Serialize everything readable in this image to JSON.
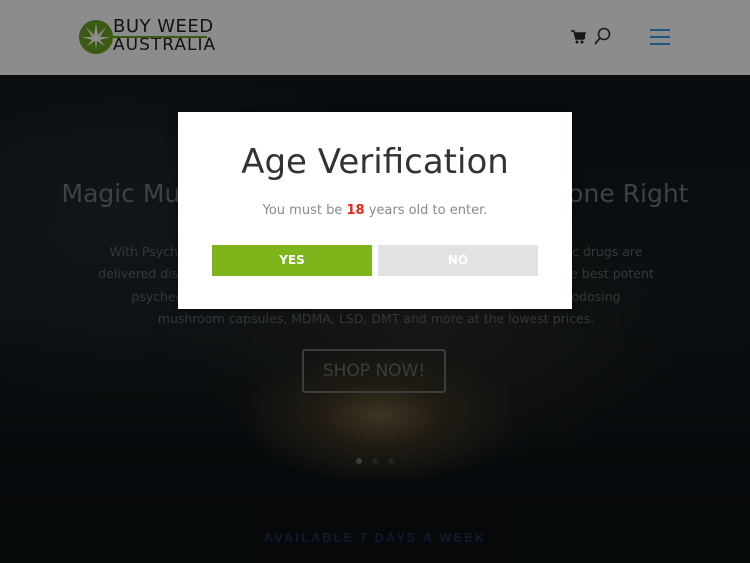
{
  "header": {
    "logo": {
      "line1": "BUY WEED",
      "line2": "AUSTRALIA"
    },
    "icons": [
      "cart-icon",
      "search-icon",
      "menu-icon"
    ],
    "accent_color": "#2ea3f2",
    "logo_green": "#6aa524"
  },
  "hero": {
    "title": "Magic Mushrooms Delivered Australia, Done Right",
    "body": "With Psychedelics Australia, your magic mushrooms and other psychedelic drugs are delivered discreetly right to your door. We specialize in sourcing some of the best potent psychedelics from around the globe including magic mushrooms, microdosing mushroom capsules, MDMA, LSD, DMT and more at the lowest prices.",
    "cta_label": "SHOP NOW!",
    "slides": 3,
    "active_slide": 1
  },
  "band": {
    "text": "AVAILABLE 7 DAYS A WEEK"
  },
  "age_gate": {
    "title": "Age Verification",
    "msg_prefix": "You must be ",
    "age": "18",
    "msg_suffix": " years old to enter.",
    "yes_label": "YES",
    "no_label": "NO",
    "yes_color": "#7db51a",
    "no_color": "#e2e2e2",
    "age_color": "#e0281b"
  }
}
